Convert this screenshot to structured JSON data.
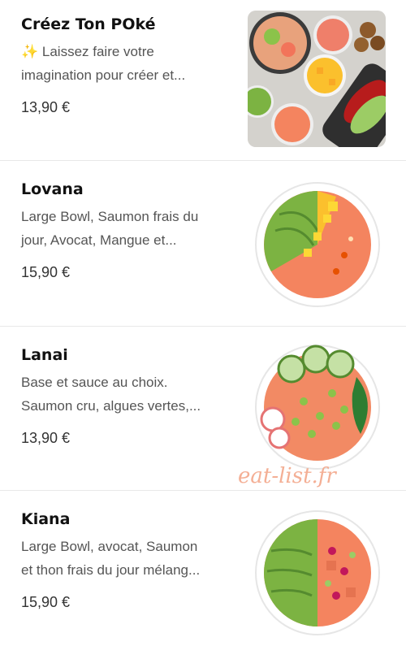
{
  "items": [
    {
      "name": "Créez Ton POké",
      "desc_line1": "✨ Laissez faire votre",
      "desc_line2": "imagination pour créer et...",
      "price": "13,90 €"
    },
    {
      "name": "Lovana",
      "desc_line1": "Large Bowl, Saumon frais du",
      "desc_line2": "jour, Avocat, Mangue et...",
      "price": "15,90 €"
    },
    {
      "name": "Lanai",
      "desc_line1": "Base et sauce au choix.",
      "desc_line2": "Saumon cru, algues vertes,...",
      "price": "13,90 €"
    },
    {
      "name": "Kiana",
      "desc_line1": "Large Bowl, avocat, Saumon",
      "desc_line2": "et thon frais du jour mélang...",
      "price": "15,90 €"
    }
  ],
  "watermark": "eat-list.fr",
  "colors": {
    "avocado": "#7cb342",
    "salmon": "#f4845f",
    "mango": "#fbc02d",
    "separator": "#e8e8e8"
  }
}
